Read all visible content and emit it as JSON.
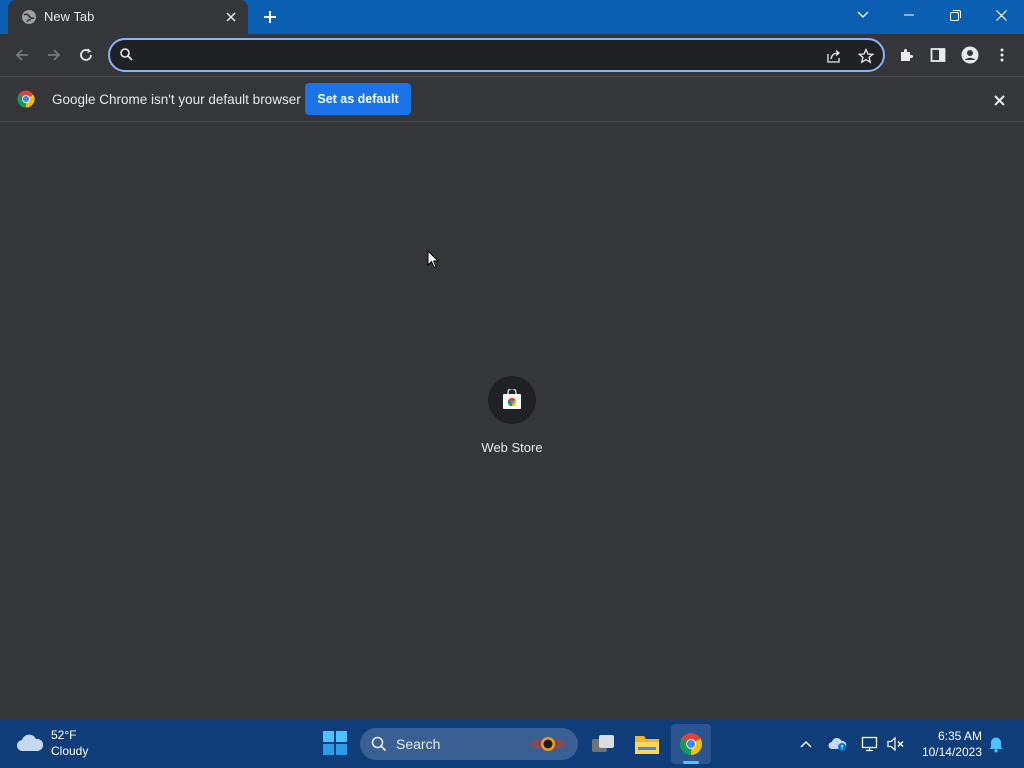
{
  "browser": {
    "tab": {
      "title": "New Tab"
    },
    "omnibox": {
      "value": "",
      "placeholder": ""
    },
    "infobar": {
      "message": "Google Chrome isn't your default browser",
      "button_label": "Set as default"
    },
    "shortcuts": [
      {
        "label": "Web Store"
      }
    ]
  },
  "taskbar": {
    "weather": {
      "temp": "52°F",
      "condition": "Cloudy"
    },
    "search_label": "Search",
    "clock": {
      "time": "6:35 AM",
      "date": "10/14/2023"
    }
  },
  "colors": {
    "titlebar": "#0b5fb3",
    "page_bg": "#35363a",
    "accent": "#8ab4f8",
    "button_blue": "#1a73e8",
    "taskbar": "#0e3d7a"
  }
}
